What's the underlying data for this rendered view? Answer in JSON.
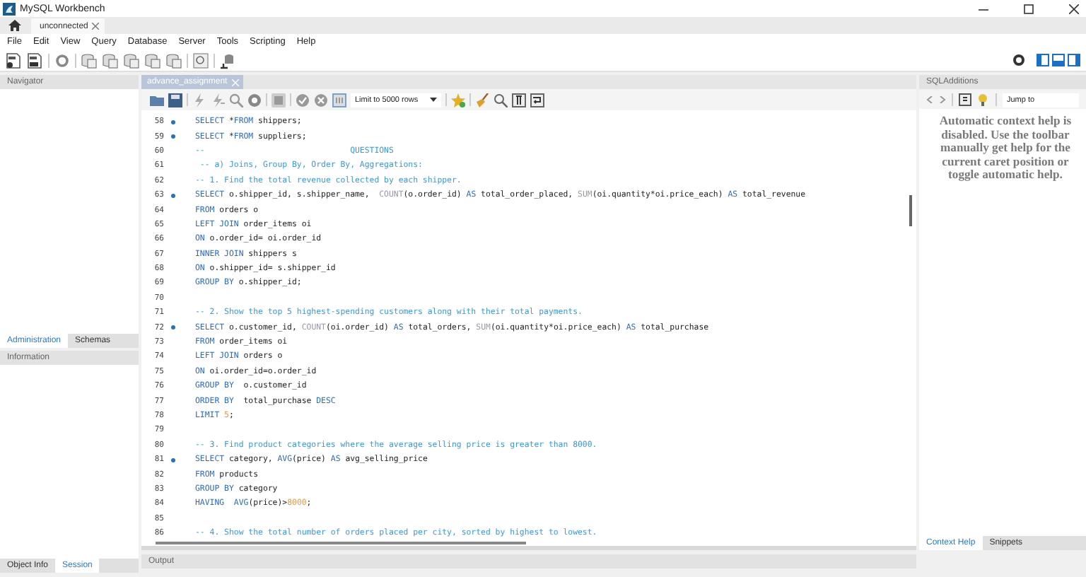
{
  "window": {
    "title": "MySQL Workbench"
  },
  "connection_tabs": [
    {
      "label": "unconnected",
      "selected": true
    }
  ],
  "menu": [
    "File",
    "Edit",
    "View",
    "Query",
    "Database",
    "Server",
    "Tools",
    "Scripting",
    "Help"
  ],
  "navigator": {
    "title": "Navigator",
    "tabs": [
      {
        "label": "Administration",
        "selected": true
      },
      {
        "label": "Schemas",
        "selected": false
      }
    ],
    "info_title": "Information",
    "bottom_tabs": [
      {
        "label": "Object Info",
        "selected": false
      },
      {
        "label": "Session",
        "selected": true
      }
    ]
  },
  "editor": {
    "tabs": [
      {
        "label": "advance_assignment",
        "selected": true
      }
    ],
    "limit": "Limit to 5000 rows",
    "output_title": "Output",
    "lines": [
      {
        "number": "58",
        "marker": true,
        "tokens": [
          {
            "kind": "keyword",
            "text": "SELECT"
          },
          {
            "kind": "plain",
            "text": " *"
          },
          {
            "kind": "keyword",
            "text": "FROM"
          },
          {
            "kind": "plain",
            "text": " shippers;"
          }
        ]
      },
      {
        "number": "59",
        "marker": true,
        "tokens": [
          {
            "kind": "keyword",
            "text": "SELECT"
          },
          {
            "kind": "plain",
            "text": " *"
          },
          {
            "kind": "keyword",
            "text": "FROM"
          },
          {
            "kind": "plain",
            "text": " suppliers;"
          }
        ]
      },
      {
        "number": "60",
        "marker": false,
        "tokens": [
          {
            "kind": "comment",
            "text": "--                              QUESTIONS"
          }
        ]
      },
      {
        "number": "61",
        "marker": false,
        "tokens": [
          {
            "kind": "comment",
            "text": " -- a) Joins, Group By, Order By, Aggregations:"
          }
        ]
      },
      {
        "number": "62",
        "marker": false,
        "tokens": [
          {
            "kind": "comment",
            "text": "-- 1. Find the total revenue collected by each shipper."
          }
        ]
      },
      {
        "number": "63",
        "marker": true,
        "tokens": [
          {
            "kind": "keyword",
            "text": "SELECT"
          },
          {
            "kind": "plain",
            "text": " o.shipper_id, s.shipper_name,  "
          },
          {
            "kind": "function",
            "text": "COUNT"
          },
          {
            "kind": "plain",
            "text": "(o.order_id) "
          },
          {
            "kind": "keyword",
            "text": "AS"
          },
          {
            "kind": "plain",
            "text": " total_order_placed, "
          },
          {
            "kind": "function",
            "text": "SUM"
          },
          {
            "kind": "plain",
            "text": "(oi.quantity*oi.price_each) "
          },
          {
            "kind": "keyword",
            "text": "AS"
          },
          {
            "kind": "plain",
            "text": " total_revenue"
          }
        ]
      },
      {
        "number": "64",
        "marker": false,
        "tokens": [
          {
            "kind": "keyword",
            "text": "FROM"
          },
          {
            "kind": "plain",
            "text": " orders o"
          }
        ]
      },
      {
        "number": "65",
        "marker": false,
        "tokens": [
          {
            "kind": "keyword",
            "text": "LEFT JOIN"
          },
          {
            "kind": "plain",
            "text": " order_items oi"
          }
        ]
      },
      {
        "number": "66",
        "marker": false,
        "tokens": [
          {
            "kind": "keyword",
            "text": "ON"
          },
          {
            "kind": "plain",
            "text": " o.order_id= oi.order_id"
          }
        ]
      },
      {
        "number": "67",
        "marker": false,
        "tokens": [
          {
            "kind": "keyword",
            "text": "INNER JOIN"
          },
          {
            "kind": "plain",
            "text": " shippers s"
          }
        ]
      },
      {
        "number": "68",
        "marker": false,
        "tokens": [
          {
            "kind": "keyword",
            "text": "ON"
          },
          {
            "kind": "plain",
            "text": " o.shipper_id= s.shipper_id"
          }
        ]
      },
      {
        "number": "69",
        "marker": false,
        "tokens": [
          {
            "kind": "keyword",
            "text": "GROUP BY"
          },
          {
            "kind": "plain",
            "text": " o.shipper_id;"
          }
        ]
      },
      {
        "number": "70",
        "marker": false
      },
      {
        "number": "71",
        "marker": false,
        "tokens": [
          {
            "kind": "comment",
            "text": "-- 2. Show the top 5 highest-spending customers along with their total payments."
          }
        ]
      },
      {
        "number": "72",
        "marker": true,
        "tokens": [
          {
            "kind": "keyword",
            "text": "SELECT"
          },
          {
            "kind": "plain",
            "text": " o.customer_id, "
          },
          {
            "kind": "function",
            "text": "COUNT"
          },
          {
            "kind": "plain",
            "text": "(oi.order_id) "
          },
          {
            "kind": "keyword",
            "text": "AS"
          },
          {
            "kind": "plain",
            "text": " total_orders, "
          },
          {
            "kind": "function",
            "text": "SUM"
          },
          {
            "kind": "plain",
            "text": "(oi.quantity*oi.price_each) "
          },
          {
            "kind": "keyword",
            "text": "AS"
          },
          {
            "kind": "plain",
            "text": " total_purchase"
          }
        ]
      },
      {
        "number": "73",
        "marker": false,
        "tokens": [
          {
            "kind": "keyword",
            "text": "FROM"
          },
          {
            "kind": "plain",
            "text": " order_items oi"
          }
        ]
      },
      {
        "number": "74",
        "marker": false,
        "tokens": [
          {
            "kind": "keyword",
            "text": "LEFT JOIN"
          },
          {
            "kind": "plain",
            "text": " orders o"
          }
        ]
      },
      {
        "number": "75",
        "marker": false,
        "tokens": [
          {
            "kind": "keyword",
            "text": "ON"
          },
          {
            "kind": "plain",
            "text": " oi.order_id=o.order_id"
          }
        ]
      },
      {
        "number": "76",
        "marker": false,
        "tokens": [
          {
            "kind": "keyword",
            "text": "GROUP BY"
          },
          {
            "kind": "plain",
            "text": "  o.customer_id"
          }
        ]
      },
      {
        "number": "77",
        "marker": false,
        "tokens": [
          {
            "kind": "keyword",
            "text": "ORDER BY"
          },
          {
            "kind": "plain",
            "text": "  total_purchase "
          },
          {
            "kind": "keyword",
            "text": "DESC"
          }
        ]
      },
      {
        "number": "78",
        "marker": false,
        "tokens": [
          {
            "kind": "keyword",
            "text": "LIMIT "
          },
          {
            "kind": "number",
            "text": "5"
          },
          {
            "kind": "plain",
            "text": ";"
          }
        ]
      },
      {
        "number": "79",
        "marker": false
      },
      {
        "number": "80",
        "marker": false,
        "tokens": [
          {
            "kind": "comment",
            "text": "-- 3. Find product categories where the average selling price is greater than 8000."
          }
        ]
      },
      {
        "number": "81",
        "marker": true,
        "tokens": [
          {
            "kind": "keyword",
            "text": "SELECT"
          },
          {
            "kind": "plain",
            "text": " category, "
          },
          {
            "kind": "keyword",
            "text": "AVG"
          },
          {
            "kind": "plain",
            "text": "(price) "
          },
          {
            "kind": "keyword",
            "text": "AS"
          },
          {
            "kind": "plain",
            "text": " avg_selling_price"
          }
        ]
      },
      {
        "number": "82",
        "marker": false,
        "tokens": [
          {
            "kind": "keyword",
            "text": "FROM"
          },
          {
            "kind": "plain",
            "text": " products"
          }
        ]
      },
      {
        "number": "83",
        "marker": false,
        "tokens": [
          {
            "kind": "keyword",
            "text": "GROUP BY"
          },
          {
            "kind": "plain",
            "text": " category"
          }
        ]
      },
      {
        "number": "84",
        "marker": false,
        "tokens": [
          {
            "kind": "keyword",
            "text": "HAVING  "
          },
          {
            "kind": "keyword",
            "text": "AVG"
          },
          {
            "kind": "plain",
            "text": "(price)>"
          },
          {
            "kind": "number",
            "text": "8000"
          },
          {
            "kind": "plain",
            "text": ";"
          }
        ]
      },
      {
        "number": "85",
        "marker": false
      },
      {
        "number": "86",
        "marker": false,
        "tokens": [
          {
            "kind": "comment",
            "text": "-- 4. Show the total number of orders placed per city, sorted by highest to lowest."
          }
        ]
      }
    ]
  },
  "sql_additions": {
    "title": "SQLAdditions",
    "jump_to": "Jump to",
    "help_lines": [
      "Automatic context help is",
      "disabled. Use the toolbar",
      "manually get help for the",
      "current caret position or",
      "toggle automatic help."
    ],
    "tabs": [
      {
        "label": "Context Help",
        "selected": true
      },
      {
        "label": "Snippets",
        "selected": false
      }
    ]
  }
}
